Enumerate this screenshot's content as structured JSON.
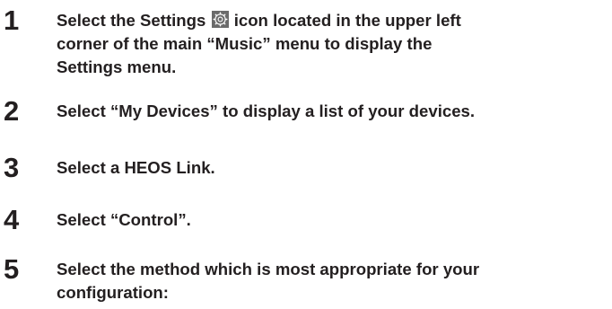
{
  "steps": [
    {
      "number": "1",
      "text_before_icon": "Select the Settings ",
      "icon": "settings-gear-icon",
      "text_after_icon": " icon located in the upper left",
      "lines": [
        "corner of the main “Music” menu to display the",
        "Settings menu."
      ]
    },
    {
      "number": "2",
      "text": "Select “My Devices” to display a list of your devices."
    },
    {
      "number": "3",
      "text": "Select a HEOS Link."
    },
    {
      "number": "4",
      "text": "Select “Control”."
    },
    {
      "number": "5",
      "lines": [
        "Select the method which is most appropriate for your",
        "configuration:"
      ]
    }
  ]
}
